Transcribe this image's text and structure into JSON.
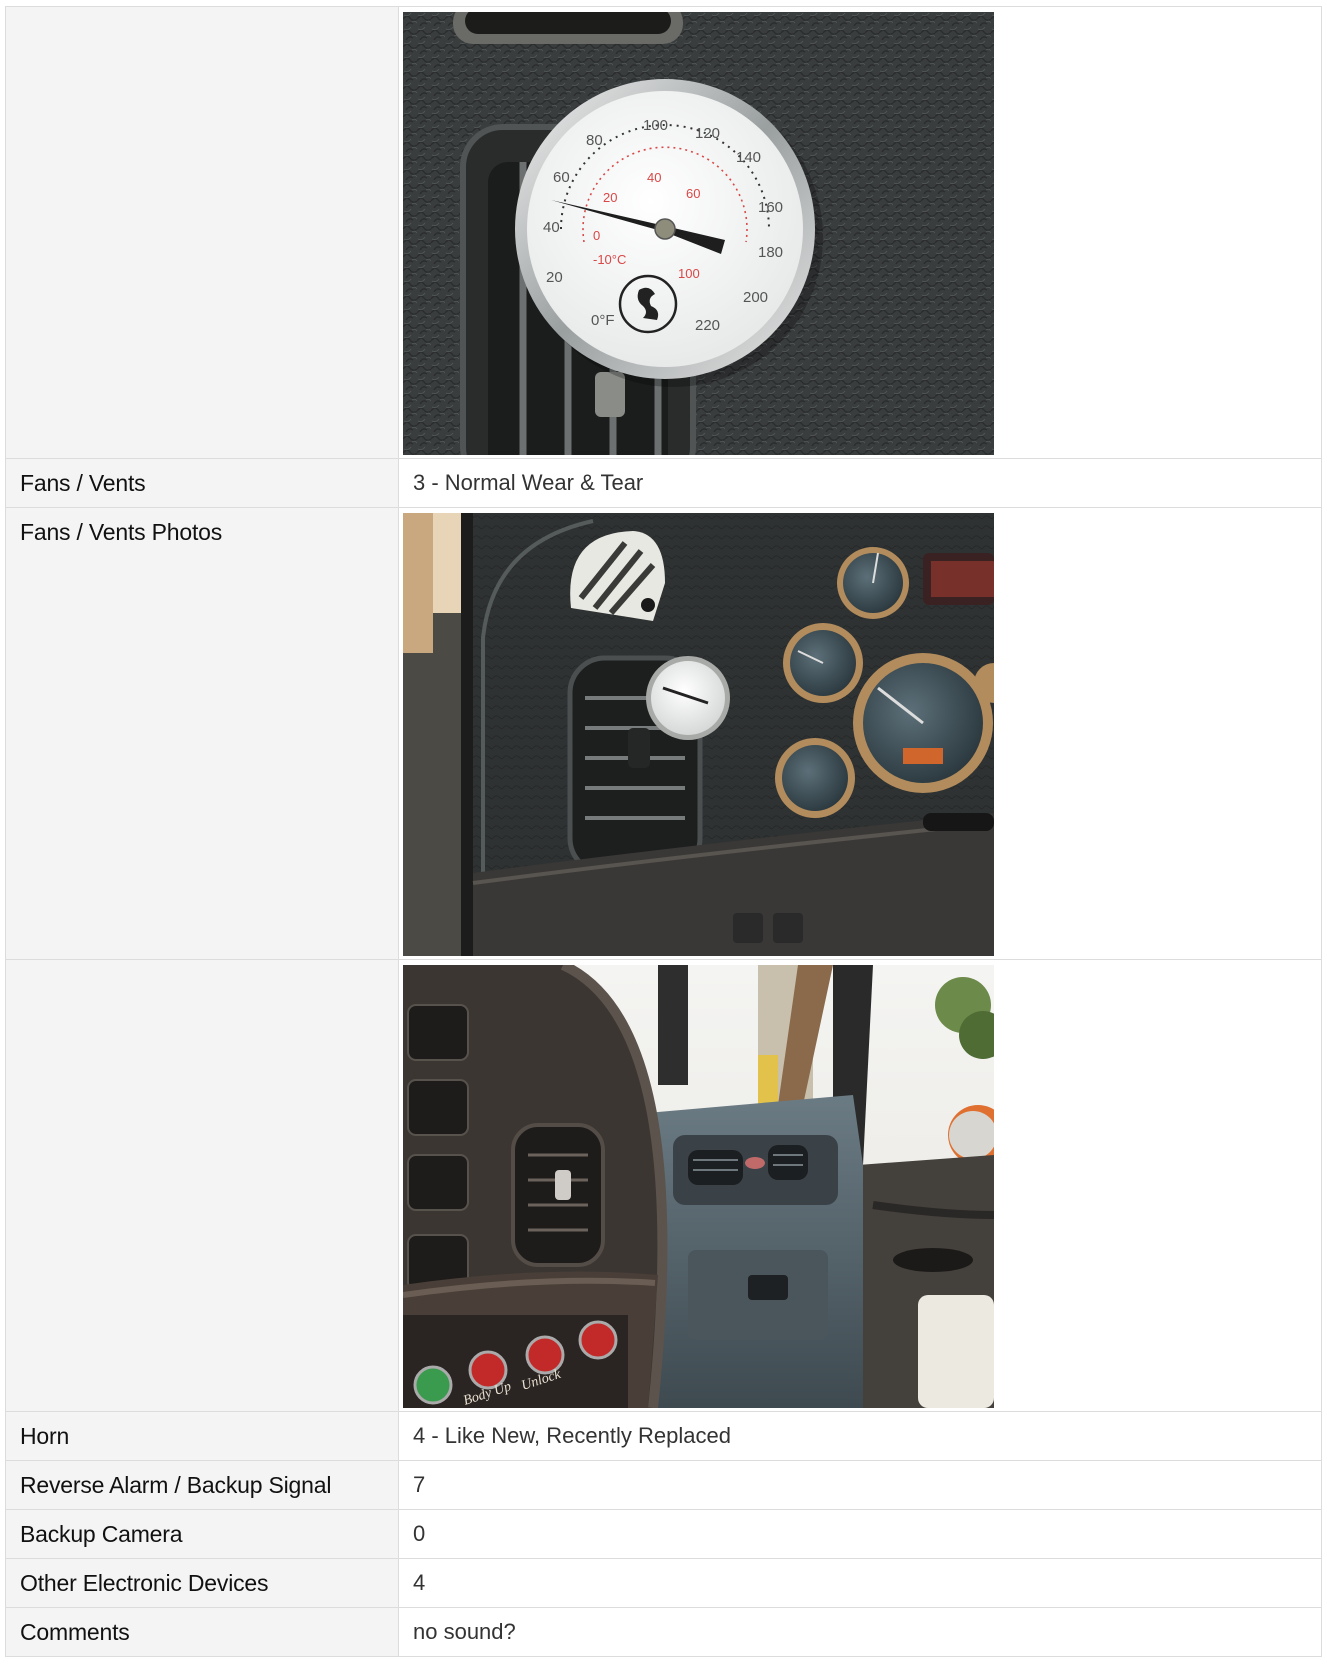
{
  "rows": [
    {
      "type": "photo",
      "label": "",
      "photo": "thermometer-on-vent-closeup"
    },
    {
      "type": "text",
      "label": "Fans / Vents",
      "value": "3 - Normal Wear & Tear"
    },
    {
      "type": "photo",
      "label": "Fans / Vents Photos",
      "photo": "dashboard-vent-with-gauges"
    },
    {
      "type": "photo",
      "label": "",
      "photo": "truck-cab-interior-vents"
    },
    {
      "type": "text",
      "label": "Horn",
      "value": "4 - Like New, Recently Replaced"
    },
    {
      "type": "text",
      "label": "Reverse Alarm / Backup Signal",
      "value": "7"
    },
    {
      "type": "text",
      "label": "Backup Camera",
      "value": "0"
    },
    {
      "type": "text",
      "label": "Other Electronic Devices",
      "value": "4"
    },
    {
      "type": "text",
      "label": "Comments",
      "value": "no sound?"
    }
  ],
  "thermometer": {
    "fahrenheit_ticks": [
      "0°F",
      "20",
      "40",
      "60",
      "80",
      "100",
      "120",
      "140",
      "160",
      "180",
      "200",
      "220"
    ],
    "celsius_ticks": [
      "-10°C",
      "0",
      "20",
      "40",
      "60",
      "100"
    ]
  },
  "dash_panel": {
    "buttons": [
      "Unlock",
      "Body Up"
    ]
  }
}
